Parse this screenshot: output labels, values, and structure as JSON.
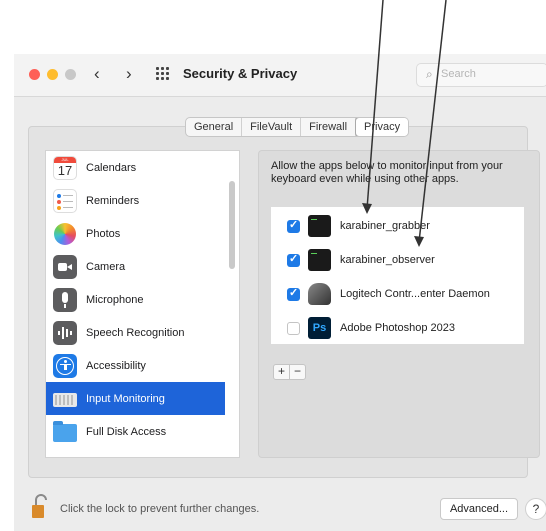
{
  "window": {
    "title": "Security & Privacy",
    "back_icon": "‹",
    "forward_icon": "›",
    "search_placeholder": "Search",
    "traffic_lights": {
      "close": "#fe5f57",
      "minimize": "#febc2e",
      "zoom": "#c8c8c8"
    }
  },
  "tabs": [
    {
      "label": "General"
    },
    {
      "label": "FileVault"
    },
    {
      "label": "Firewall"
    },
    {
      "label": "Privacy",
      "active": true
    }
  ],
  "sidebar": {
    "items": [
      {
        "label": "Calendars",
        "icon": "calendar-icon",
        "calendar_day": "17",
        "calendar_month": "JUL"
      },
      {
        "label": "Reminders",
        "icon": "reminders-icon"
      },
      {
        "label": "Photos",
        "icon": "photos-icon"
      },
      {
        "label": "Camera",
        "icon": "camera-icon"
      },
      {
        "label": "Microphone",
        "icon": "microphone-icon"
      },
      {
        "label": "Speech Recognition",
        "icon": "speech-recognition-icon"
      },
      {
        "label": "Accessibility",
        "icon": "accessibility-icon"
      },
      {
        "label": "Input Monitoring",
        "icon": "keyboard-icon",
        "selected": true
      },
      {
        "label": "Full Disk Access",
        "icon": "folder-icon"
      }
    ]
  },
  "main": {
    "description": "Allow the apps below to monitor input from your keyboard even while using other apps.",
    "apps": [
      {
        "name": "karabiner_grabber",
        "checked": true,
        "icon": "terminal-icon"
      },
      {
        "name": "karabiner_observer",
        "checked": true,
        "icon": "terminal-icon"
      },
      {
        "name": "Logitech Contr...enter Daemon",
        "checked": true,
        "icon": "logitech-icon"
      },
      {
        "name": "Adobe Photoshop 2023",
        "checked": false,
        "icon": "photoshop-icon",
        "icon_text": "Ps"
      }
    ],
    "add_label": "+",
    "remove_label": "−"
  },
  "footer": {
    "lock_text": "Click the lock to prevent further changes.",
    "advanced_label": "Advanced...",
    "help_label": "?"
  },
  "colors": {
    "accent": "#1e64d9",
    "checkbox": "#1e7ae6"
  }
}
